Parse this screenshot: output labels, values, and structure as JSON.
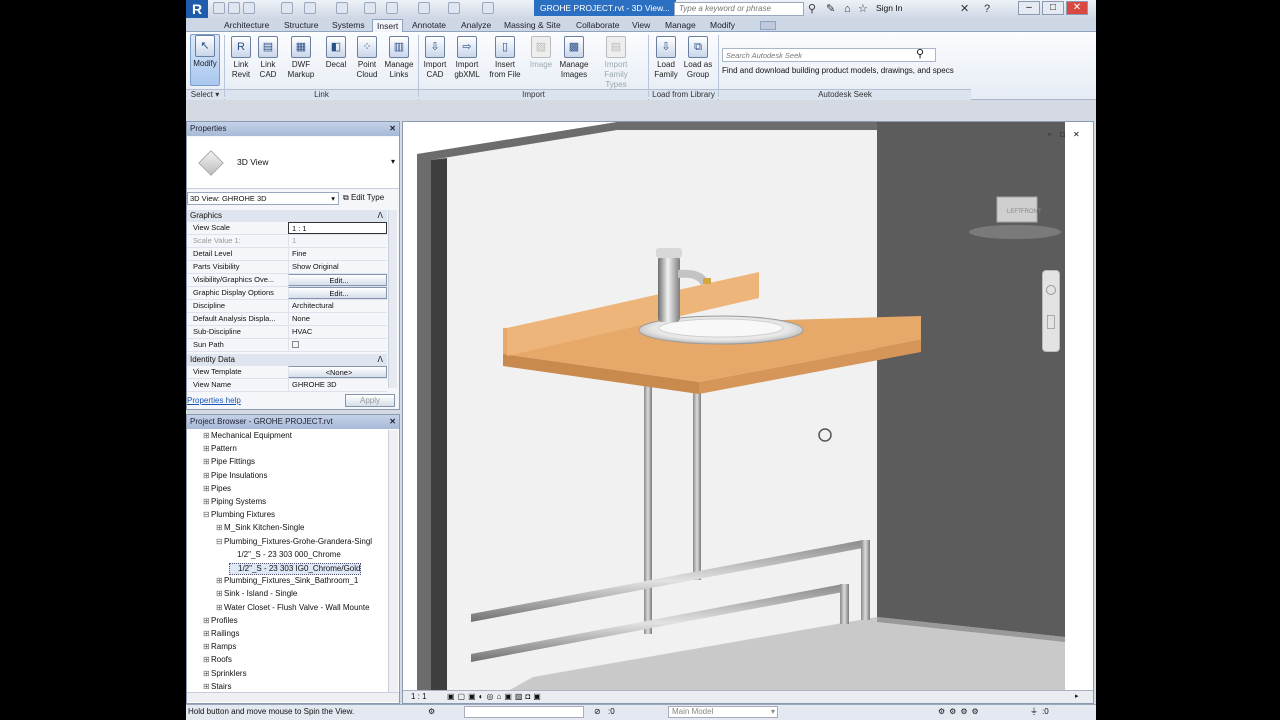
{
  "titlebar": {
    "logo": "R",
    "doc_title": "GROHE PROJECT.rvt - 3D View...",
    "search_placeholder": "Type a keyword or phrase",
    "sign_in": "Sign In"
  },
  "tabs": [
    "Architecture",
    "Structure",
    "Systems",
    "Insert",
    "Annotate",
    "Analyze",
    "Massing & Site",
    "Collaborate",
    "View",
    "Manage",
    "Modify"
  ],
  "active_tab": "Insert",
  "ribbon": {
    "buttons": [
      {
        "l1": "Modify",
        "l2": "",
        "icon": "cursor-icon"
      },
      {
        "l1": "Link",
        "l2": "Revit",
        "icon": "link-revit-icon"
      },
      {
        "l1": "Link",
        "l2": "CAD",
        "icon": "link-cad-icon"
      },
      {
        "l1": "DWF",
        "l2": "Markup",
        "icon": "dwf-icon"
      },
      {
        "l1": "Decal",
        "l2": "",
        "icon": "decal-icon"
      },
      {
        "l1": "Point",
        "l2": "Cloud",
        "icon": "point-cloud-icon"
      },
      {
        "l1": "Manage",
        "l2": "Links",
        "icon": "manage-links-icon"
      },
      {
        "l1": "Import",
        "l2": "CAD",
        "icon": "import-cad-icon"
      },
      {
        "l1": "Import",
        "l2": "gbXML",
        "icon": "gbxml-icon"
      },
      {
        "l1": "Insert",
        "l2": "from File",
        "icon": "insert-file-icon"
      },
      {
        "l1": "Image",
        "l2": "",
        "icon": "image-icon"
      },
      {
        "l1": "Manage",
        "l2": "Images",
        "icon": "manage-images-icon"
      },
      {
        "l1": "Import",
        "l2": "Family Types",
        "icon": "family-types-icon"
      },
      {
        "l1": "Load",
        "l2": "Family",
        "icon": "load-family-icon"
      },
      {
        "l1": "Load as",
        "l2": "Group",
        "icon": "load-group-icon"
      }
    ],
    "panels": [
      "Select",
      "Link",
      "Import",
      "Load from Library",
      "Autodesk Seek"
    ],
    "seek_placeholder": "Search Autodesk Seek",
    "seek_desc": "Find and download building product models, drawings, and specs"
  },
  "properties": {
    "title": "Properties",
    "type_name": "3D View",
    "selector": "3D View: GHROHE 3D",
    "edit_type": "Edit Type",
    "group1": "Graphics",
    "rows": [
      {
        "k": "View Scale",
        "v": "1 : 1"
      },
      {
        "k": "Scale Value    1:",
        "v": "1"
      },
      {
        "k": "Detail Level",
        "v": "Fine"
      },
      {
        "k": "Parts Visibility",
        "v": "Show Original"
      },
      {
        "k": "Visibility/Graphics Ove...",
        "v": "Edit..."
      },
      {
        "k": "Graphic Display Options",
        "v": "Edit..."
      },
      {
        "k": "Discipline",
        "v": "Architectural"
      },
      {
        "k": "Default Analysis Displa...",
        "v": "None"
      },
      {
        "k": "Sub-Discipline",
        "v": "HVAC"
      },
      {
        "k": "Sun Path",
        "v": ""
      }
    ],
    "group2": "Identity Data",
    "rows2": [
      {
        "k": "View Template",
        "v": "<None>"
      },
      {
        "k": "View Name",
        "v": "GHROHE 3D"
      }
    ],
    "help": "Properties help",
    "apply": "Apply"
  },
  "browser": {
    "title": "Project Browser - GROHE PROJECT.rvt",
    "items": [
      {
        "lvl": 1,
        "pm": "⊞",
        "t": "Mechanical Equipment"
      },
      {
        "lvl": 1,
        "pm": "⊞",
        "t": "Pattern"
      },
      {
        "lvl": 1,
        "pm": "⊞",
        "t": "Pipe Fittings"
      },
      {
        "lvl": 1,
        "pm": "⊞",
        "t": "Pipe Insulations"
      },
      {
        "lvl": 1,
        "pm": "⊞",
        "t": "Pipes"
      },
      {
        "lvl": 1,
        "pm": "⊞",
        "t": "Piping Systems"
      },
      {
        "lvl": 1,
        "pm": "⊟",
        "t": "Plumbing Fixtures"
      },
      {
        "lvl": 2,
        "pm": "⊞",
        "t": "M_Sink Kitchen-Single"
      },
      {
        "lvl": 2,
        "pm": "⊟",
        "t": "Plumbing_Fixtures-Grohe-Grandera-Singl"
      },
      {
        "lvl": 3,
        "pm": "",
        "t": "1/2\"_S - 23 303 000_Chrome"
      },
      {
        "lvl": 3,
        "pm": "",
        "t": "1/2\"_S - 23 303 IG0_Chrome/Gold"
      },
      {
        "lvl": 2,
        "pm": "⊞",
        "t": "Plumbing_Fixtures_Sink_Bathroom_1"
      },
      {
        "lvl": 2,
        "pm": "⊞",
        "t": "Sink - Island - Single"
      },
      {
        "lvl": 2,
        "pm": "⊞",
        "t": "Water Closet - Flush Valve - Wall Mounte"
      },
      {
        "lvl": 1,
        "pm": "⊞",
        "t": "Profiles"
      },
      {
        "lvl": 1,
        "pm": "⊞",
        "t": "Railings"
      },
      {
        "lvl": 1,
        "pm": "⊞",
        "t": "Ramps"
      },
      {
        "lvl": 1,
        "pm": "⊞",
        "t": "Roofs"
      },
      {
        "lvl": 1,
        "pm": "⊞",
        "t": "Sprinklers"
      },
      {
        "lvl": 1,
        "pm": "⊞",
        "t": "Stairs"
      }
    ],
    "selected_index": 10
  },
  "view": {
    "viewcube_left": "LEFT",
    "viewcube_front": "FRONT",
    "scale": "1 : 1"
  },
  "status": {
    "message": "Hold button and move mouse to Spin the View.",
    "zero": ":0",
    "model": "Main Model",
    "filter": ":0"
  }
}
